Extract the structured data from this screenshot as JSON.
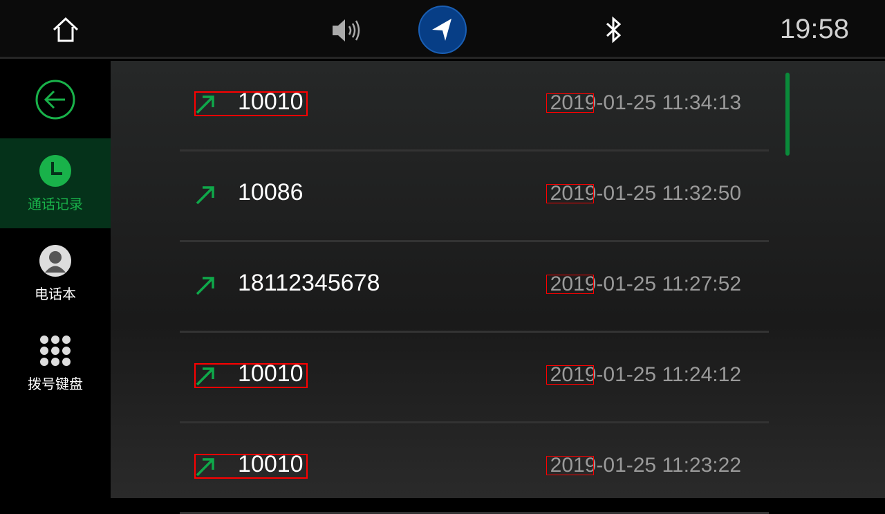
{
  "topbar": {
    "time": "19:58",
    "icons": [
      "home-icon",
      "volume-icon",
      "navigation-icon",
      "bluetooth-icon"
    ]
  },
  "sidebar": {
    "back": "back-icon",
    "items": [
      {
        "label": "通话记录",
        "icon": "clock-icon",
        "active": true
      },
      {
        "label": "电话本",
        "icon": "contact-icon"
      },
      {
        "label": "拨号键盘",
        "icon": "dialpad-icon"
      }
    ]
  },
  "calls": [
    {
      "number": "10010",
      "time": "2019-01-25 11:34:13",
      "type": "outgoing",
      "highlight": true
    },
    {
      "number": "10086",
      "time": "2019-01-25 11:32:50",
      "type": "outgoing",
      "highlight": false
    },
    {
      "number": "18112345678",
      "time": "2019-01-25 11:27:52",
      "type": "outgoing",
      "highlight": false
    },
    {
      "number": "10010",
      "time": "2019-01-25 11:24:12",
      "type": "outgoing",
      "highlight": true
    },
    {
      "number": "10010",
      "time": "2019-01-25 11:23:22",
      "type": "outgoing",
      "highlight": true
    }
  ],
  "colors": {
    "accent": "#19b24a",
    "nav": "#073e86"
  }
}
